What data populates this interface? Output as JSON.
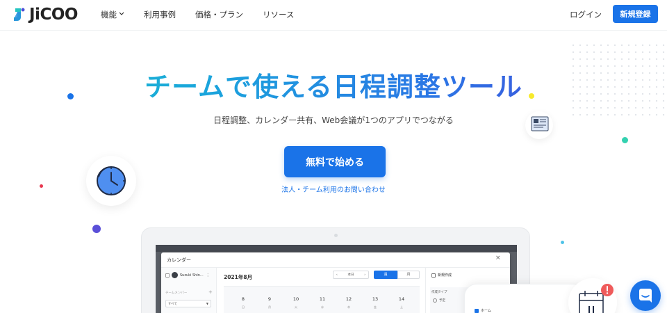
{
  "header": {
    "logo_text": "JiCOO",
    "nav": [
      {
        "label": "機能",
        "has_dropdown": true
      },
      {
        "label": "利用事例"
      },
      {
        "label": "価格・プラン"
      },
      {
        "label": "リソース"
      }
    ],
    "login_label": "ログイン",
    "signup_label": "新規登録"
  },
  "hero": {
    "title": "チームで使える日程調整ツール",
    "subtitle": "日程調整、カレンダー共有、Web会議が1つのアプリでつながる",
    "cta_label": "無料で始める",
    "contact_link": "法人・チーム利用のお問い合わせ"
  },
  "mockup": {
    "modal_title": "カレンダー",
    "close_glyph": "×",
    "user_name": "Suzuki Shin...",
    "user_menu_glyph": "⋮",
    "team_label": "チームメンバー",
    "team_add_glyph": "+",
    "team_select_value": "すべて",
    "select_arrow_glyph": "▼",
    "month_label": "2021年8月",
    "nav_prev": "‹",
    "nav_today": "本日",
    "nav_next": "›",
    "view_week": "週",
    "view_month": "月",
    "days": [
      {
        "num": "8",
        "wd": "日"
      },
      {
        "num": "9",
        "wd": "月"
      },
      {
        "num": "10",
        "wd": "火"
      },
      {
        "num": "11",
        "wd": "水"
      },
      {
        "num": "12",
        "wd": "木"
      },
      {
        "num": "13",
        "wd": "金"
      },
      {
        "num": "14",
        "wd": "土"
      }
    ],
    "right_new_label": "新規作成",
    "right_type_label": "作成タイプ",
    "right_radio_label": "予定",
    "phone_home_label": "ホーム"
  },
  "colors": {
    "brand_blue": "#1a73e8",
    "title_gradient_start": "#1ec2c9",
    "title_gradient_end": "#4a3fd8"
  },
  "icons": [
    "logo-mark-icon",
    "chevron-down-icon",
    "clock-icon",
    "document-icon",
    "calendar-alert-icon",
    "chat-icon"
  ]
}
